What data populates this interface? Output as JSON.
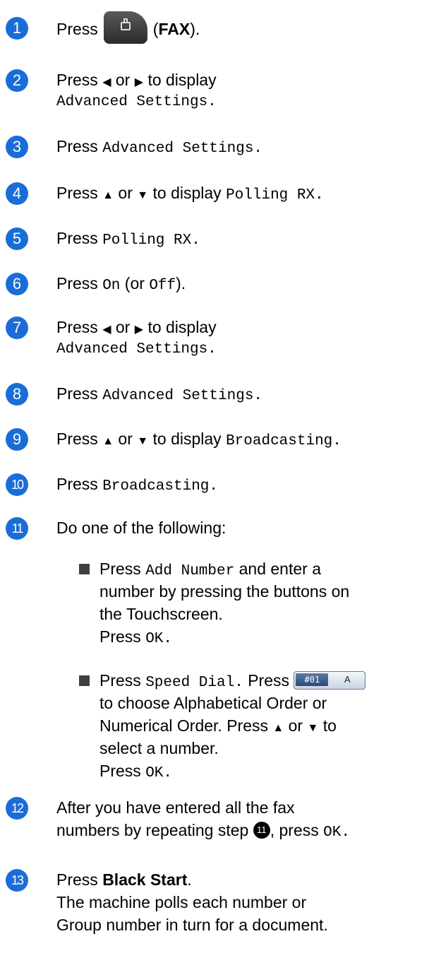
{
  "steps": [
    {
      "num": "1",
      "parts": [
        "Press",
        "(",
        "FAX",
        ")."
      ]
    },
    {
      "num": "2",
      "line1": "Press",
      "mid": "or",
      "end": "to display",
      "line2": "Advanced Settings."
    },
    {
      "num": "3",
      "press": "Press",
      "mono": "Advanced Settings."
    },
    {
      "num": "4",
      "press": "Press",
      "mid": "or",
      "end": "to display",
      "mono": "Polling RX."
    },
    {
      "num": "5",
      "press": "Press",
      "mono": "Polling RX."
    },
    {
      "num": "6",
      "press": "Press",
      "on": "On",
      "paren_or": "(or",
      "off": "Off",
      "close": ")."
    },
    {
      "num": "7",
      "line1": "Press",
      "mid": "or",
      "end": "to display",
      "line2": "Advanced Settings."
    },
    {
      "num": "8",
      "press": "Press",
      "mono": "Advanced Settings."
    },
    {
      "num": "9",
      "press": "Press",
      "mid": "or",
      "end": "to display",
      "mono": "Broadcasting."
    },
    {
      "num": "10",
      "press": "Press",
      "mono": "Broadcasting."
    },
    {
      "num": "11",
      "text": "Do one of the following:"
    },
    {
      "num": "12",
      "line1a": "After you have entered all the fax",
      "line2a": "numbers by repeating step",
      "ref": "11",
      "line2b": ", press",
      "ok": "OK."
    },
    {
      "num": "13",
      "press": "Press",
      "bold": "Black Start",
      "dot": ".",
      "line2": "The machine polls each number or",
      "line3": "Group number in turn for a document."
    }
  ],
  "bullets": [
    {
      "press": "Press",
      "mono": "Add Number",
      "rest1": "and enter a",
      "rest2": "number by pressing the buttons on",
      "rest3": "the Touchscreen.",
      "press2": "Press",
      "ok": "OK."
    },
    {
      "press": "Press",
      "mono": "Speed Dial.",
      "press_b": "Press",
      "btn_left": "#01",
      "btn_right": "A",
      "rest1": "to choose Alphabetical Order or",
      "rest2a": "Numerical Order. Press",
      "mid": "or",
      "rest3": "select a number.",
      "to": "to",
      "press2": "Press",
      "ok": "OK."
    }
  ],
  "icons": {
    "fax": "fax-icon",
    "left": "◀",
    "right": "▶",
    "up": "▲",
    "down": "▼"
  },
  "colors": {
    "step_circle": "#1a6dd8"
  }
}
